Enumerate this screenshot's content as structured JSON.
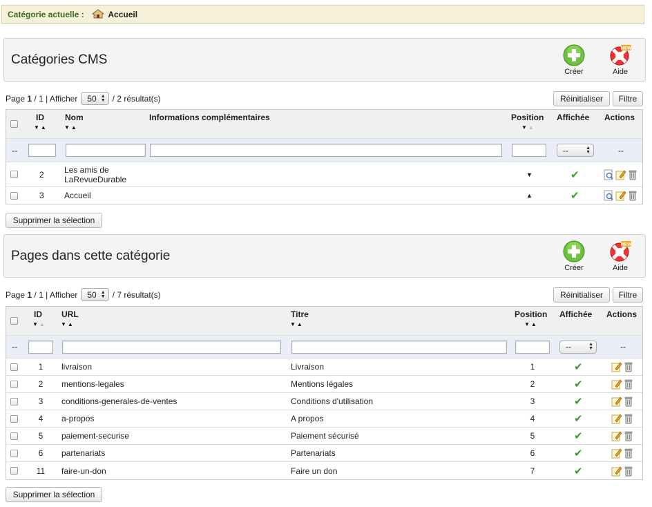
{
  "breadcrumb": {
    "label": "Catégorie actuelle :",
    "current": "Accueil"
  },
  "toolbar_labels": {
    "create": "Créer",
    "help": "Aide",
    "new_badge": "NEW"
  },
  "common": {
    "page_word": "Page",
    "show_word": "| Afficher",
    "reset": "Réinitialiser",
    "filter": "Filtre",
    "delete_selection": "Supprimer la sélection",
    "dash": "--",
    "select_dash": "--"
  },
  "categories_panel": {
    "title": "Catégories CMS",
    "pager": {
      "current": "1",
      "total": "/ 1",
      "per_page": "50",
      "results": "/ 2 résultat(s)"
    },
    "columns": {
      "id": "ID",
      "name": "Nom",
      "info": "Informations complémentaires",
      "position": "Position",
      "displayed": "Affichée",
      "actions": "Actions"
    },
    "rows": [
      {
        "id": "2",
        "name": "Les amis de LaRevueDurable",
        "position_arrow": "▼",
        "displayed": true
      },
      {
        "id": "3",
        "name": "Accueil",
        "position_arrow": "▲",
        "displayed": true
      }
    ]
  },
  "pages_panel": {
    "title": "Pages dans cette catégorie",
    "pager": {
      "current": "1",
      "total": "/ 1",
      "per_page": "50",
      "results": "/ 7 résultat(s)"
    },
    "columns": {
      "id": "ID",
      "url": "URL",
      "title": "Titre",
      "position": "Position",
      "displayed": "Affichée",
      "actions": "Actions"
    },
    "rows": [
      {
        "id": "1",
        "url": "livraison",
        "title": "Livraison",
        "position": "1",
        "displayed": true
      },
      {
        "id": "2",
        "url": "mentions-legales",
        "title": "Mentions légales",
        "position": "2",
        "displayed": true
      },
      {
        "id": "3",
        "url": "conditions-generales-de-ventes",
        "title": "Conditions d'utilisation",
        "position": "3",
        "displayed": true
      },
      {
        "id": "4",
        "url": "a-propos",
        "title": "A propos",
        "position": "4",
        "displayed": true
      },
      {
        "id": "5",
        "url": "paiement-securise",
        "title": "Paiement sécurisé",
        "position": "5",
        "displayed": true
      },
      {
        "id": "6",
        "url": "partenariats",
        "title": "Partenariats",
        "position": "6",
        "displayed": true
      },
      {
        "id": "11",
        "url": "faire-un-don",
        "title": "Faire un don",
        "position": "7",
        "displayed": true
      }
    ]
  },
  "colors": {
    "accent_green": "#3c9a2c",
    "breadcrumb_bg": "#f5f0d9",
    "filter_row_bg": "#e9eef7"
  }
}
